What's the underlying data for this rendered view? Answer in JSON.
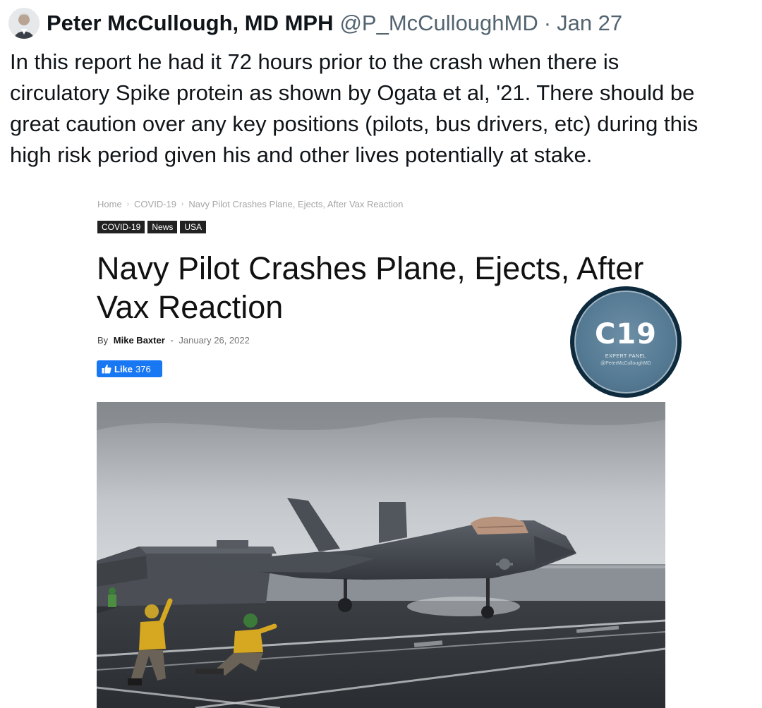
{
  "tweet": {
    "author_name": "Peter McCullough, MD MPH",
    "handle": "@P_McCulloughMD",
    "separator": "·",
    "date": "Jan 27",
    "text": "In this report he had it 72 hours prior to the crash when there is\ncirculatory Spike protein as shown by Ogata et al, '21.  There should be\ngreat caution over any key positions (pilots, bus drivers, etc) during this\nhigh risk period given his and other lives potentially at stake."
  },
  "article": {
    "breadcrumb": [
      "Home",
      "COVID-19",
      "Navy Pilot Crashes Plane, Ejects, After Vax Reaction"
    ],
    "breadcrumb_separator": "›",
    "tags": [
      "COVID-19",
      "News",
      "USA"
    ],
    "title": "Navy Pilot Crashes Plane, Ejects, After Vax Reaction",
    "byline_prefix": "By",
    "author": "Mike Baxter",
    "byline_dash": "-",
    "date": "January 26, 2022",
    "like_label": "Like",
    "like_count": "376"
  },
  "badge": {
    "title": "C19",
    "subtitle": "EXPERT PANEL",
    "handle": "@PeterMcCulloughMD"
  },
  "colors": {
    "like_blue": "#1877f2",
    "tag_bg": "#222222",
    "handle_gray": "#536471",
    "badge_blue": "#557a93"
  },
  "icons": [
    "thumbs-up-icon",
    "avatar",
    "fighter-jet-photo"
  ]
}
